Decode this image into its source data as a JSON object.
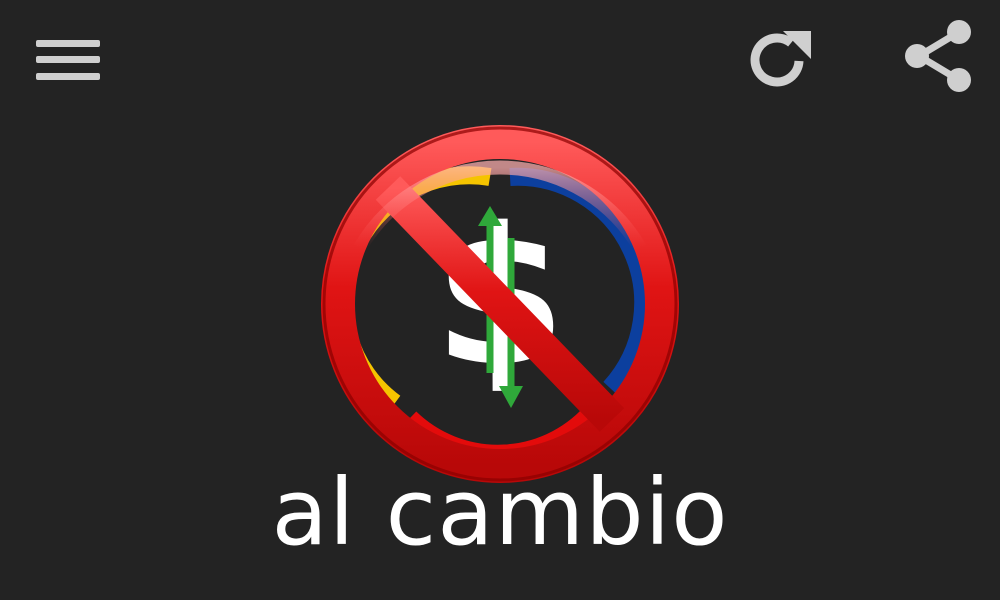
{
  "toolbar": {
    "menu_icon": "hamburger-menu-icon",
    "refresh_icon": "refresh-icon",
    "share_icon": "share-icon",
    "icon_color": "#cfcfcf"
  },
  "logo": {
    "brand_name": "al cambio",
    "currency_symbol": "$",
    "ring_colors": {
      "yellow": "#f5c400",
      "blue": "#0c3f9e",
      "red": "#e30b0b"
    },
    "arrow_color": "#2fa83a",
    "prohibition_color": "#e01414"
  },
  "colors": {
    "background": "#232323",
    "text": "#ffffff"
  }
}
